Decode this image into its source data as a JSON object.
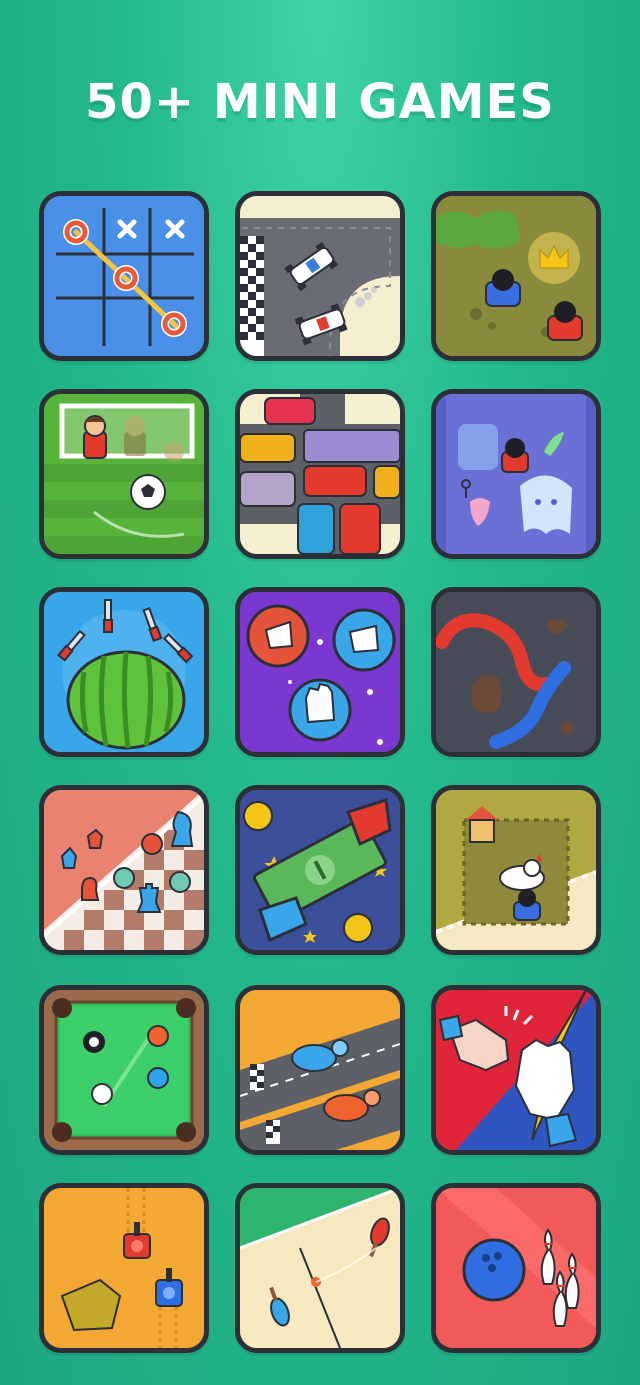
{
  "header": {
    "title": "50+ MINI GAMES"
  },
  "games": [
    {
      "icon": "tic-tac-toe-icon"
    },
    {
      "icon": "race-car-icon"
    },
    {
      "icon": "crown-battle-icon"
    },
    {
      "icon": "soccer-goal-icon"
    },
    {
      "icon": "traffic-jam-icon"
    },
    {
      "icon": "ghost-hunt-icon"
    },
    {
      "icon": "watermelon-knife-icon"
    },
    {
      "icon": "rock-paper-scissors-icon"
    },
    {
      "icon": "snake-icon"
    },
    {
      "icon": "chess-checkers-icon"
    },
    {
      "icon": "money-grab-icon"
    },
    {
      "icon": "chicken-chase-icon"
    },
    {
      "icon": "billiards-icon"
    },
    {
      "icon": "turtle-race-icon"
    },
    {
      "icon": "hand-slap-icon"
    },
    {
      "icon": "tank-battle-icon"
    },
    {
      "icon": "ping-pong-icon"
    },
    {
      "icon": "bowling-icon"
    }
  ],
  "colors": {
    "background": "#22b98b",
    "tile_border": "#2d2f38"
  }
}
